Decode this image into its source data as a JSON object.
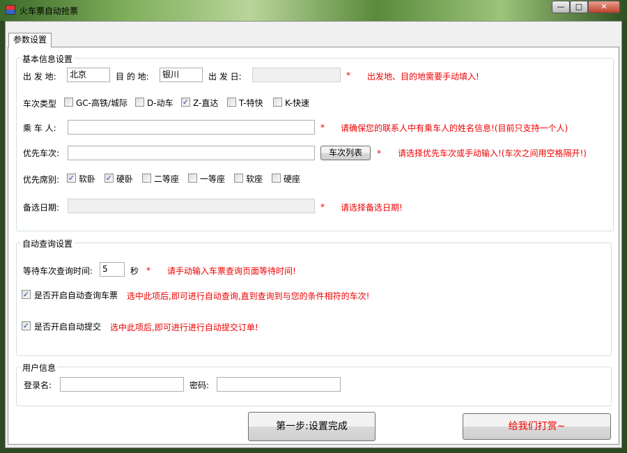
{
  "window": {
    "title": "火车票自动抢票",
    "min": "—",
    "max": "□",
    "close": "✕"
  },
  "tab": "参数设置",
  "basic": {
    "title": "基本信息设置",
    "from_label": "出 发 地:",
    "from_value": "北京",
    "to_label": "目 的 地:",
    "to_value": "银川",
    "date_label": "出 发 日:",
    "date_value": "",
    "star": "*",
    "hint1": "出发地、目的地需要手动填入!",
    "type_label": "车次类型",
    "types": [
      {
        "label": "GC-高铁/城际",
        "checked": false
      },
      {
        "label": "D-动车",
        "checked": false
      },
      {
        "label": "Z-直达",
        "checked": true
      },
      {
        "label": "T-特快",
        "checked": false
      },
      {
        "label": "K-快速",
        "checked": false
      }
    ],
    "passenger_label": "乘 车 人:",
    "passenger_value": "",
    "hint2": "请确保您的联系人中有乘车人的姓名信息!(目前只支持一个人)",
    "train_label": "优先车次:",
    "train_value": "",
    "train_list_button": "车次列表",
    "hint3": "请选择优先车次或手动输入!(车次之间用空格隔开!)",
    "seat_label": "优先席别:",
    "seats": [
      {
        "label": "软卧",
        "checked": true
      },
      {
        "label": "硬卧",
        "checked": true
      },
      {
        "label": "二等座",
        "checked": false
      },
      {
        "label": "一等座",
        "checked": false
      },
      {
        "label": "软座",
        "checked": false
      },
      {
        "label": "硬座",
        "checked": false
      }
    ],
    "alt_date_label": "备选日期:",
    "alt_date_value": "",
    "hint4": "请选择备选日期!"
  },
  "auto": {
    "title": "自动查询设置",
    "wait_label": "等待车次查询时间:",
    "wait_value": "5",
    "wait_unit": "秒",
    "hint_wait": "请手动输入车票查询页面等待时间!",
    "auto_query_label": "是否开启自动查询车票",
    "auto_query_checked": true,
    "hint_query": "选中此项后,即可进行自动查询,直到查询到与您的条件相符的车次!",
    "auto_submit_label": "是否开启自动提交",
    "auto_submit_checked": true,
    "hint_submit": "选中此项后,即可进行进行自动提交订单!"
  },
  "user": {
    "title": "用户信息",
    "login_label": "登录名:",
    "login_value": "",
    "password_label": "密码:",
    "password_value": ""
  },
  "buttons": {
    "done": "第一步:设置完成",
    "tip": "给我们打赏~"
  }
}
